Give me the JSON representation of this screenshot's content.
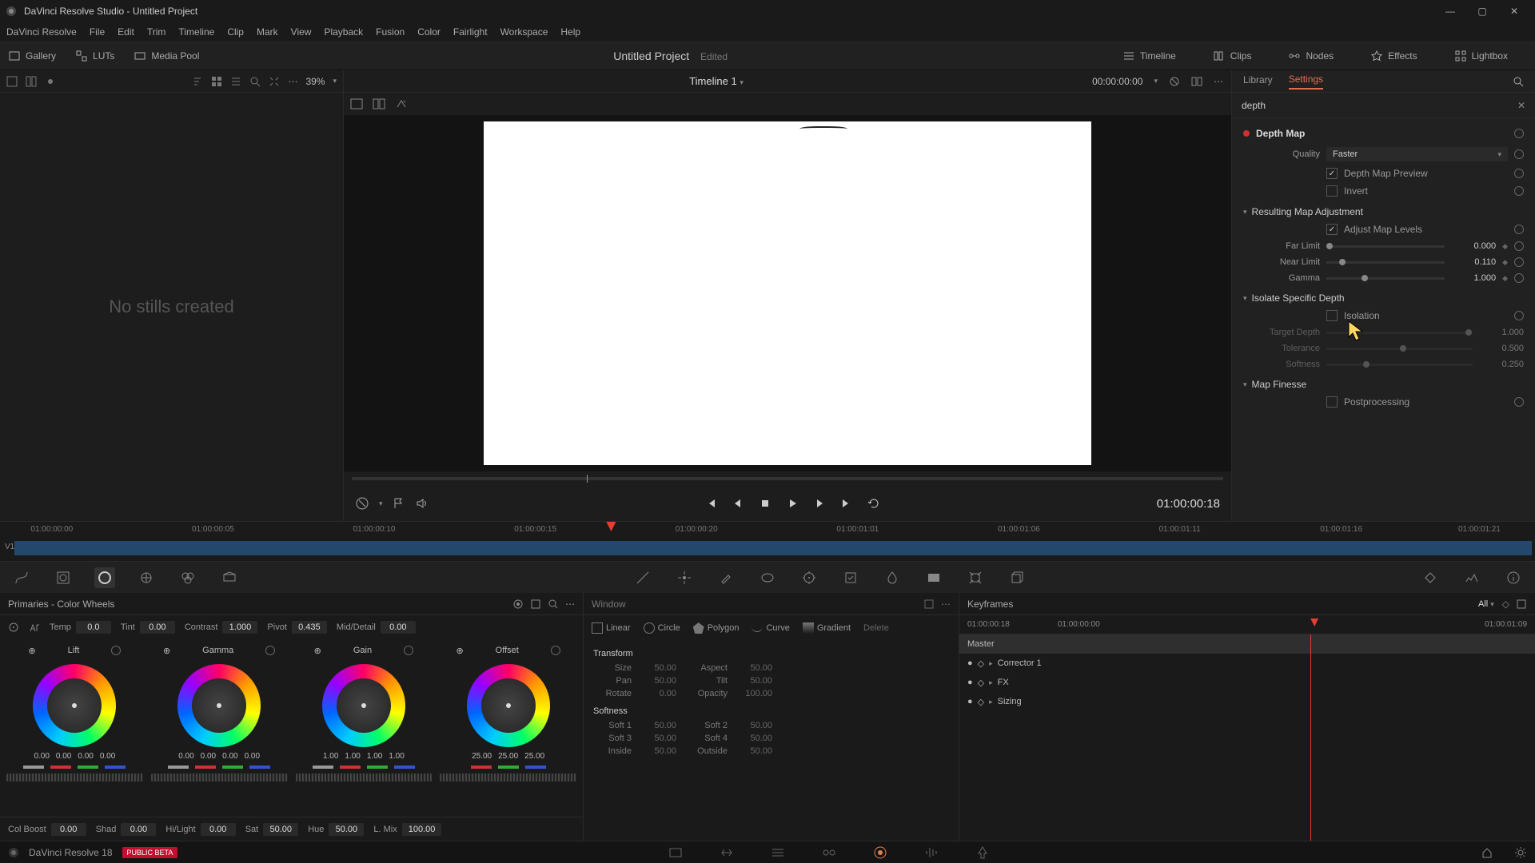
{
  "window": {
    "title": "DaVinci Resolve Studio - Untitled Project"
  },
  "menus": [
    "DaVinci Resolve",
    "File",
    "Edit",
    "Trim",
    "Timeline",
    "Clip",
    "Mark",
    "View",
    "Playback",
    "Fusion",
    "Color",
    "Fairlight",
    "Workspace",
    "Help"
  ],
  "top_tools": {
    "left": [
      "Gallery",
      "LUTs",
      "Media Pool"
    ],
    "center_title": "Untitled Project",
    "edited": "Edited",
    "right": [
      "Timeline",
      "Clips",
      "Nodes",
      "Effects",
      "Lightbox"
    ]
  },
  "gallery": {
    "empty": "No stills created",
    "zoom": "39%"
  },
  "viewer": {
    "timeline_name": "Timeline 1",
    "timecode": "00:00:00:00",
    "trans_timecode": "01:00:00:18"
  },
  "mini_tl": {
    "marks": [
      "01:00:00:00",
      "01:00:00:05",
      "01:00:00:10",
      "01:00:00:15",
      "01:00:00:20",
      "01:00:01:01",
      "01:00:01:06",
      "01:00:01:11",
      "01:00:01:16",
      "01:00:01:21"
    ],
    "track": "V1"
  },
  "effects": {
    "tabs": [
      "Library",
      "Settings"
    ],
    "active": "Settings",
    "search": "depth",
    "title": "Depth Map",
    "quality": {
      "label": "Quality",
      "value": "Faster"
    },
    "preview": {
      "label": "Depth Map Preview",
      "checked": true
    },
    "invert": {
      "label": "Invert",
      "checked": false
    },
    "section_adjust": "Resulting Map Adjustment",
    "adjust_levels": {
      "label": "Adjust Map Levels",
      "checked": true
    },
    "far": {
      "label": "Far Limit",
      "value": "0.000"
    },
    "near": {
      "label": "Near Limit",
      "value": "0.110"
    },
    "gamma": {
      "label": "Gamma",
      "value": "1.000"
    },
    "section_isolate": "Isolate Specific Depth",
    "isolation": {
      "label": "Isolation",
      "checked": false
    },
    "target": {
      "label": "Target Depth",
      "value": "1.000"
    },
    "tolerance": {
      "label": "Tolerance",
      "value": "0.500"
    },
    "softness": {
      "label": "Softness",
      "value": "0.250"
    },
    "section_finesse": "Map Finesse",
    "postproc": {
      "label": "Postprocessing",
      "checked": false
    }
  },
  "primaries": {
    "title": "Primaries - Color Wheels",
    "top": {
      "temp_l": "Temp",
      "temp": "0.0",
      "tint_l": "Tint",
      "tint": "0.00",
      "contrast_l": "Contrast",
      "contrast": "1.000",
      "pivot_l": "Pivot",
      "pivot": "0.435",
      "md_l": "Mid/Detail",
      "md": "0.00"
    },
    "wheels": [
      {
        "name": "Lift",
        "vals": [
          "0.00",
          "0.00",
          "0.00",
          "0.00"
        ]
      },
      {
        "name": "Gamma",
        "vals": [
          "0.00",
          "0.00",
          "0.00",
          "0.00"
        ]
      },
      {
        "name": "Gain",
        "vals": [
          "1.00",
          "1.00",
          "1.00",
          "1.00"
        ]
      },
      {
        "name": "Offset",
        "vals": [
          "25.00",
          "25.00",
          "25.00"
        ]
      }
    ],
    "bottom": {
      "cb_l": "Col Boost",
      "cb": "0.00",
      "sh_l": "Shad",
      "sh": "0.00",
      "hl_l": "Hi/Light",
      "hl": "0.00",
      "sat_l": "Sat",
      "sat": "50.00",
      "hue_l": "Hue",
      "hue": "50.00",
      "lm_l": "L. Mix",
      "lm": "100.00"
    }
  },
  "window_panel": {
    "title": "Window",
    "shapes": [
      "Linear",
      "Circle",
      "Polygon",
      "Curve",
      "Gradient",
      "Delete"
    ],
    "transform": "Transform",
    "size_l": "Size",
    "size": "50.00",
    "aspect_l": "Aspect",
    "aspect": "50.00",
    "pan_l": "Pan",
    "pan": "50.00",
    "tilt_l": "Tilt",
    "tilt": "50.00",
    "rotate_l": "Rotate",
    "rotate": "0.00",
    "opacity_l": "Opacity",
    "opacity": "100.00",
    "softness": "Softness",
    "s1_l": "Soft 1",
    "s1": "50.00",
    "s2_l": "Soft 2",
    "s2": "50.00",
    "s3_l": "Soft 3",
    "s3": "50.00",
    "s4_l": "Soft 4",
    "s4": "50.00",
    "in_l": "Inside",
    "in": "50.00",
    "out_l": "Outside",
    "out": "50.00"
  },
  "keyframes": {
    "title": "Keyframes",
    "all": "All",
    "tc": "01:00:00:18",
    "ruler": [
      "01:00:00:00",
      "01:00:01:09"
    ],
    "rows": [
      "Master",
      "Corrector 1",
      "FX",
      "Sizing"
    ]
  },
  "footer": {
    "app": "DaVinci Resolve 18",
    "beta": "PUBLIC BETA"
  }
}
